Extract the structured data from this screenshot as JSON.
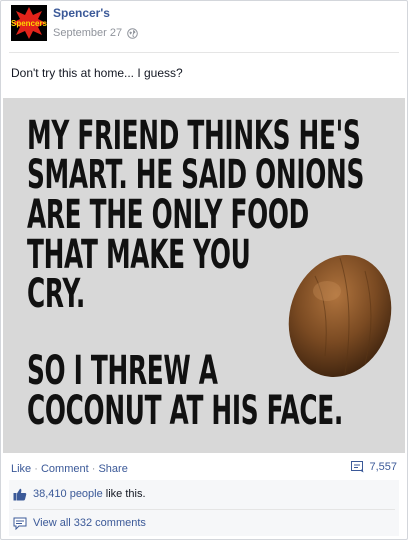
{
  "post": {
    "page_name": "Spencer's",
    "date": "September 27",
    "privacy_icon": "globe-icon",
    "text": "Don't try this at home... I guess?",
    "avatar_logo_text": "Spencers"
  },
  "photo": {
    "lines": [
      "MY FRIEND THINKS HE'S",
      "SMART. HE SAID ONIONS",
      "ARE THE ONLY FOOD",
      "THAT MAKE YOU",
      "CRY.",
      "SO I THREW A",
      "COCONUT AT HIS FACE."
    ],
    "image_icon": "coconut-icon"
  },
  "actions": {
    "like": "Like",
    "comment": "Comment",
    "share": "Share",
    "separator": "·",
    "share_count": "7,557",
    "share_icon": "share-icon"
  },
  "feedback": {
    "likes_link": "38,410 people",
    "likes_suffix": "like this.",
    "like_icon": "thumbs-up-icon",
    "comments_link": "View all 332 comments",
    "comments_icon": "comment-icon"
  },
  "colors": {
    "link": "#3b5998",
    "meta": "#90949c",
    "photo_bg": "#d8d8d8"
  }
}
